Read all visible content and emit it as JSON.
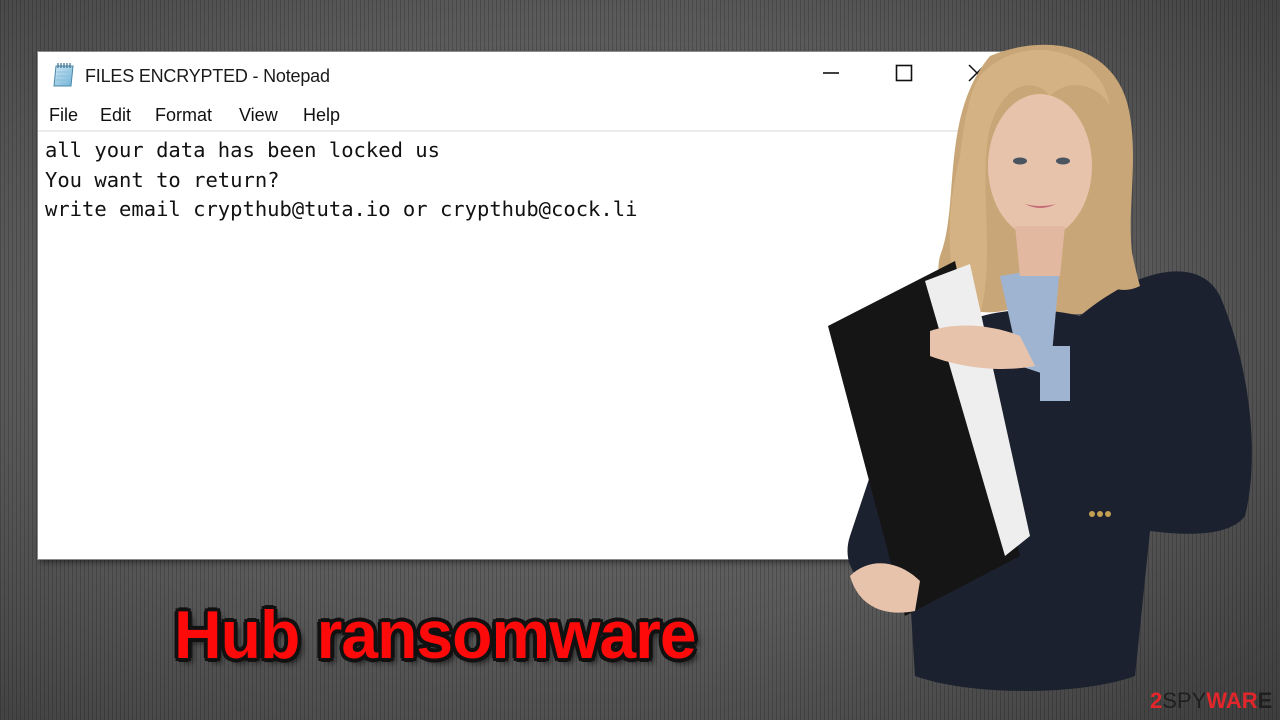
{
  "window": {
    "title": "FILES ENCRYPTED - Notepad",
    "app_icon": "notepad-icon",
    "controls": {
      "minimize": "minimize-icon",
      "maximize": "maximize-icon",
      "close": "close-icon"
    }
  },
  "menubar": {
    "items": [
      {
        "label": "File"
      },
      {
        "label": "Edit"
      },
      {
        "label": "Format"
      },
      {
        "label": "View"
      },
      {
        "label": "Help"
      }
    ]
  },
  "editor": {
    "lines": [
      "all your data has been locked us",
      "You want to return?",
      "write email crypthub@tuta.io or crypthub@cock.li"
    ]
  },
  "headline": "Hub ransomware",
  "watermark": {
    "part1": "2",
    "part2": "SPY",
    "part3": "WAR",
    "part4": "E"
  },
  "colors": {
    "headline": "#ff0a0a",
    "brand_red": "#e3262b"
  }
}
